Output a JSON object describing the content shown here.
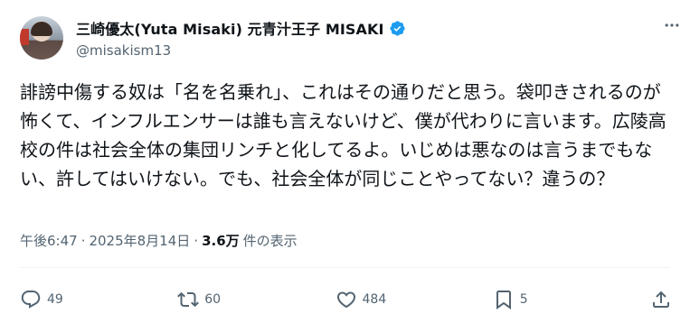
{
  "author": {
    "display_name": "三崎優太(Yuta Misaki) 元青汁王子 MISAKI",
    "handle": "@misakism13",
    "verified_badge_color": "#1d9bf0"
  },
  "more_icon": "more-horizontal-icon",
  "tweet": {
    "text": "誹謗中傷する奴は「名を名乗れ」、これはその通りだと思う。袋叩きされるのが怖くて、インフルエンサーは誰も言えないけど、僕が代わりに言います。広陵高校の件は社会全体の集団リンチと化してるよ。いじめは悪なのは言うまでもない、許してはいけない。でも、社会全体が同じことやってない？違うの？"
  },
  "meta": {
    "time": "午後6:47",
    "separator": "·",
    "date": "2025年8月14日",
    "separator2": "·",
    "views_count": "3.6万",
    "views_label": "件の表示"
  },
  "actions": {
    "reply": {
      "icon": "reply-icon",
      "count": "49"
    },
    "repost": {
      "icon": "repost-icon",
      "count": "60"
    },
    "like": {
      "icon": "like-icon",
      "count": "484"
    },
    "bookmark": {
      "icon": "bookmark-icon",
      "count": "5"
    },
    "share": {
      "icon": "share-icon"
    }
  },
  "colors": {
    "text_primary": "#0f1419",
    "text_secondary": "#536471",
    "divider": "#eff3f4"
  }
}
